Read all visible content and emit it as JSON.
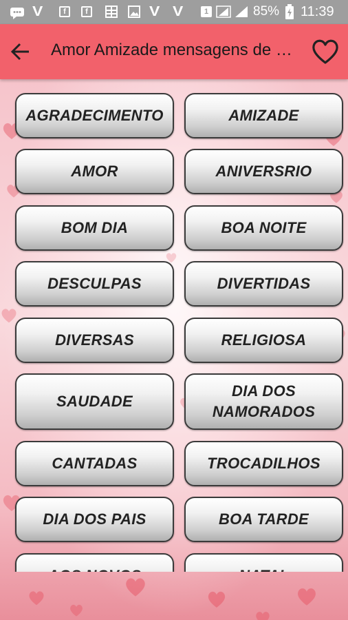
{
  "status_bar": {
    "battery_percent": "85%",
    "time": "11:39",
    "icons": [
      "message-icon",
      "viber-icon",
      "facebook-icon",
      "facebook-icon",
      "gallery-icon",
      "photo-icon",
      "viber-icon",
      "viber-icon",
      "sim-1-icon",
      "signal-icon",
      "signal-icon",
      "battery-charging-icon"
    ]
  },
  "app_bar": {
    "title": "Amor Amizade mensagens de Carinho",
    "back_icon": "arrow-back-icon",
    "favorite_icon": "heart-outline-icon",
    "background_color": "#f2616b"
  },
  "categories": [
    {
      "label": "AGRADECIMENTO"
    },
    {
      "label": "AMIZADE"
    },
    {
      "label": "AMOR"
    },
    {
      "label": "ANIVERSRIO"
    },
    {
      "label": "BOM DIA"
    },
    {
      "label": "BOA NOITE"
    },
    {
      "label": "DESCULPAS"
    },
    {
      "label": "DIVERTIDAS"
    },
    {
      "label": "DIVERSAS"
    },
    {
      "label": "RELIGIOSA"
    },
    {
      "label": "SAUDADE"
    },
    {
      "label": "DIA DOS\nNAMORADOS"
    },
    {
      "label": "CANTADAS"
    },
    {
      "label": "TROCADILHOS"
    },
    {
      "label": "DIA DOS PAIS"
    },
    {
      "label": "BOA TARDE"
    },
    {
      "label": "AOS NOVOS"
    },
    {
      "label": "NATAL"
    }
  ]
}
